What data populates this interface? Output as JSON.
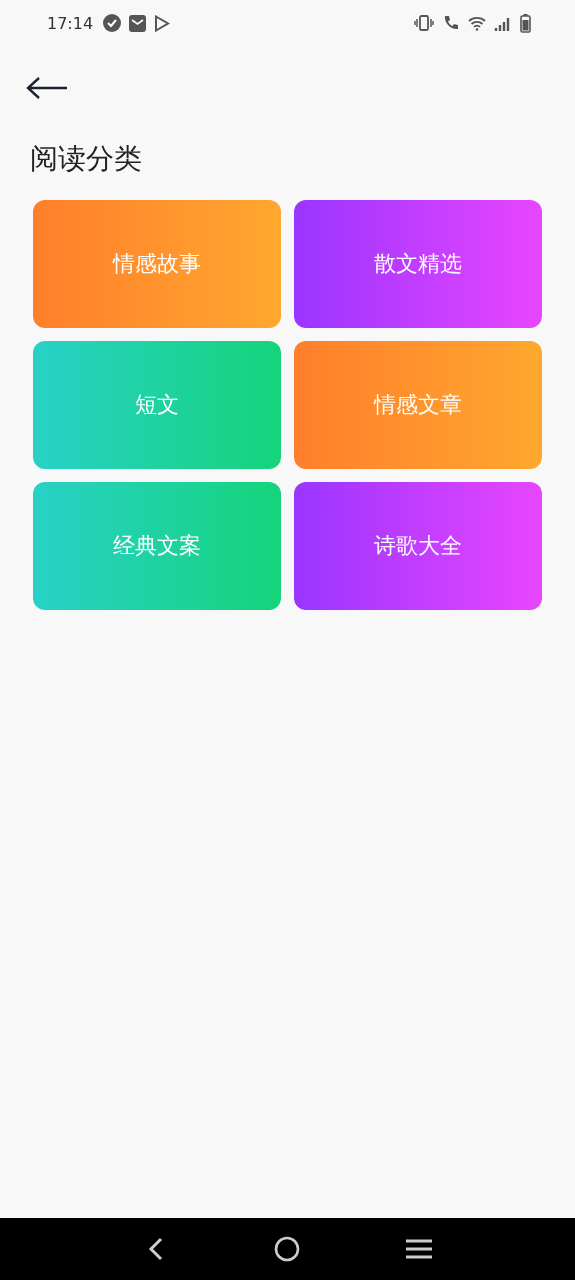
{
  "status_bar": {
    "time": "17:14"
  },
  "header": {
    "title": "阅读分类"
  },
  "categories": [
    {
      "label": "情感故事",
      "kind": "orange"
    },
    {
      "label": "散文精选",
      "kind": "purple"
    },
    {
      "label": "短文",
      "kind": "green"
    },
    {
      "label": "情感文章",
      "kind": "orange"
    },
    {
      "label": "经典文案",
      "kind": "green"
    },
    {
      "label": "诗歌大全",
      "kind": "purple"
    }
  ]
}
